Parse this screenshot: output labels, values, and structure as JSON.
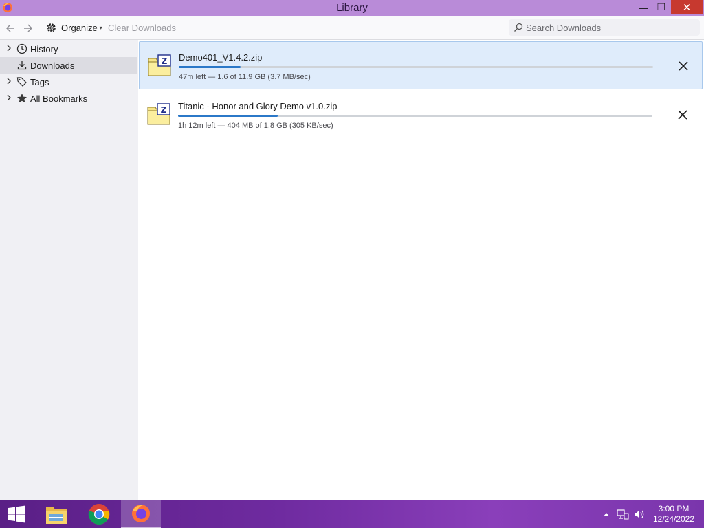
{
  "window": {
    "title": "Library",
    "controls": {
      "minimize": "—",
      "maximize": "❐",
      "close": "✕"
    }
  },
  "toolbar": {
    "back_icon": "arrow-left-icon",
    "forward_icon": "arrow-right-icon",
    "organize_label": "Organize",
    "organize_caret": "▾",
    "clear_downloads_label": "Clear Downloads",
    "search_placeholder": "Search Downloads",
    "search_value": ""
  },
  "sidebar": {
    "items": [
      {
        "label": "History",
        "icon": "clock-icon",
        "expandable": true,
        "selected": false
      },
      {
        "label": "Downloads",
        "icon": "download-icon",
        "expandable": false,
        "selected": true
      },
      {
        "label": "Tags",
        "icon": "tag-icon",
        "expandable": true,
        "selected": false
      },
      {
        "label": "All Bookmarks",
        "icon": "star-icon",
        "expandable": true,
        "selected": false
      }
    ]
  },
  "downloads": [
    {
      "name": "Demo401_V1.4.2.zip",
      "status": "47m left — 1.6 of 11.9 GB (3.7 MB/sec)",
      "progress": 0.13,
      "selected": true
    },
    {
      "name": "Titanic - Honor and Glory Demo v1.0.zip",
      "status": "1h 12m left — 404 MB of 1.8 GB (305 KB/sec)",
      "progress": 0.21,
      "selected": false
    }
  ],
  "taskbar": {
    "apps": [
      "windows-start-icon",
      "file-explorer-icon",
      "chrome-icon",
      "firefox-icon"
    ],
    "active_app": "firefox-icon",
    "time": "3:00 PM",
    "date": "12/24/2022"
  },
  "colors": {
    "titlebar": "#b98bd8",
    "close_button": "#c7392f",
    "selection": "#dfecfb",
    "progress": "#2b78c8"
  }
}
